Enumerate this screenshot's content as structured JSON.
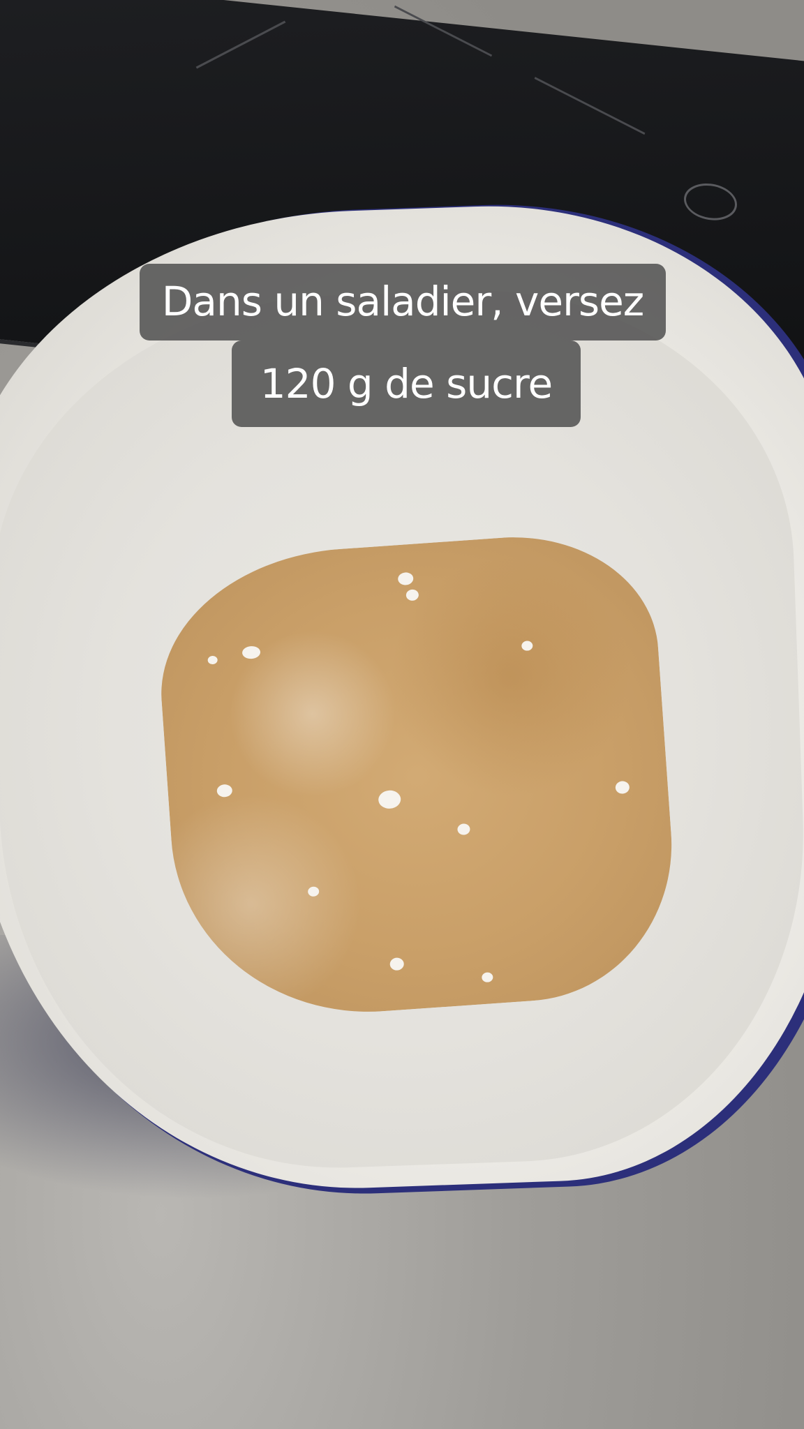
{
  "caption": {
    "line1": "Dans un saladier, versez",
    "line2": "120 g de sucre"
  }
}
